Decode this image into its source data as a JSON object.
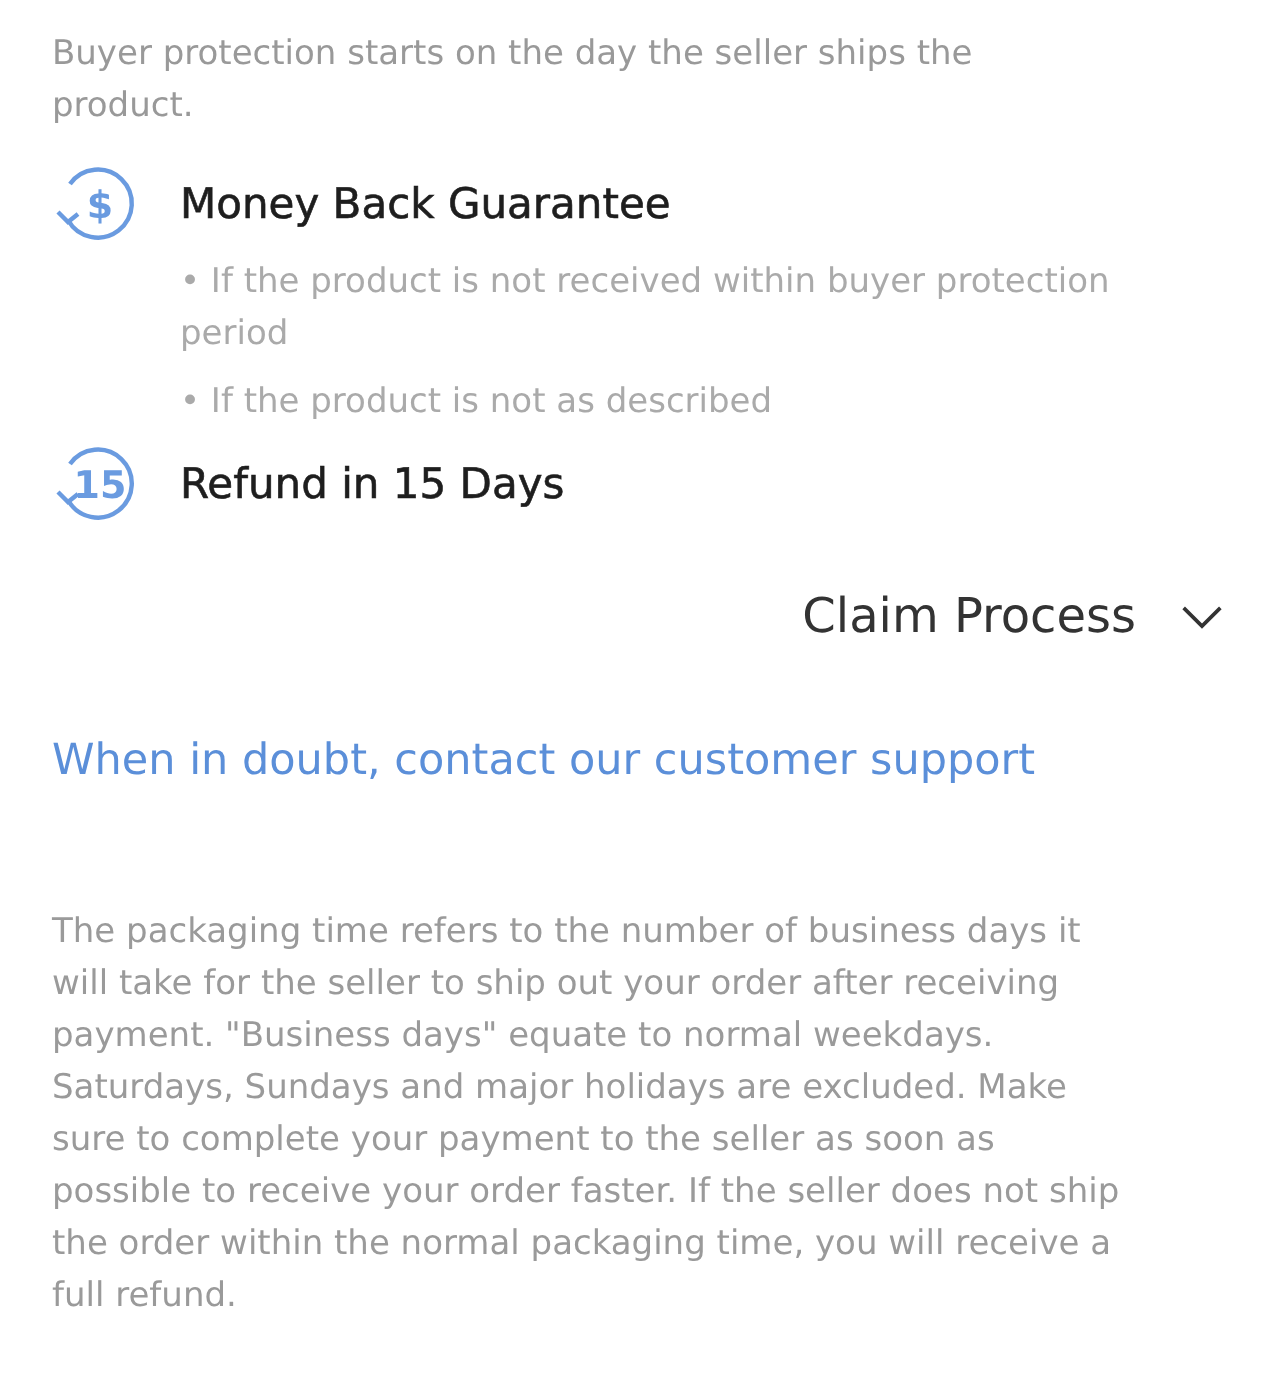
{
  "intro": "Buyer protection starts on the day the seller ships the product.",
  "guarantees": [
    {
      "icon_text": "$",
      "title": "Money Back Guarantee",
      "bullets": [
        "• If the product is not received within buyer protection period",
        "• If the product is not as described"
      ]
    },
    {
      "icon_text": "15",
      "title": "Refund in 15 Days"
    }
  ],
  "claim_process": {
    "label": "Claim Process",
    "expanded": false
  },
  "support_link": "When in doubt, contact our customer support",
  "note": "The packaging time refers to the number of business days it will take for the seller to ship out your order after receiving payment. \"Business days\" equate to normal weekdays. Saturdays, Sundays and major holidays are excluded. Make sure to complete your payment to the seller as soon as possible to receive your order faster. If the seller does not ship the order within the normal packaging time, you will receive a full refund."
}
